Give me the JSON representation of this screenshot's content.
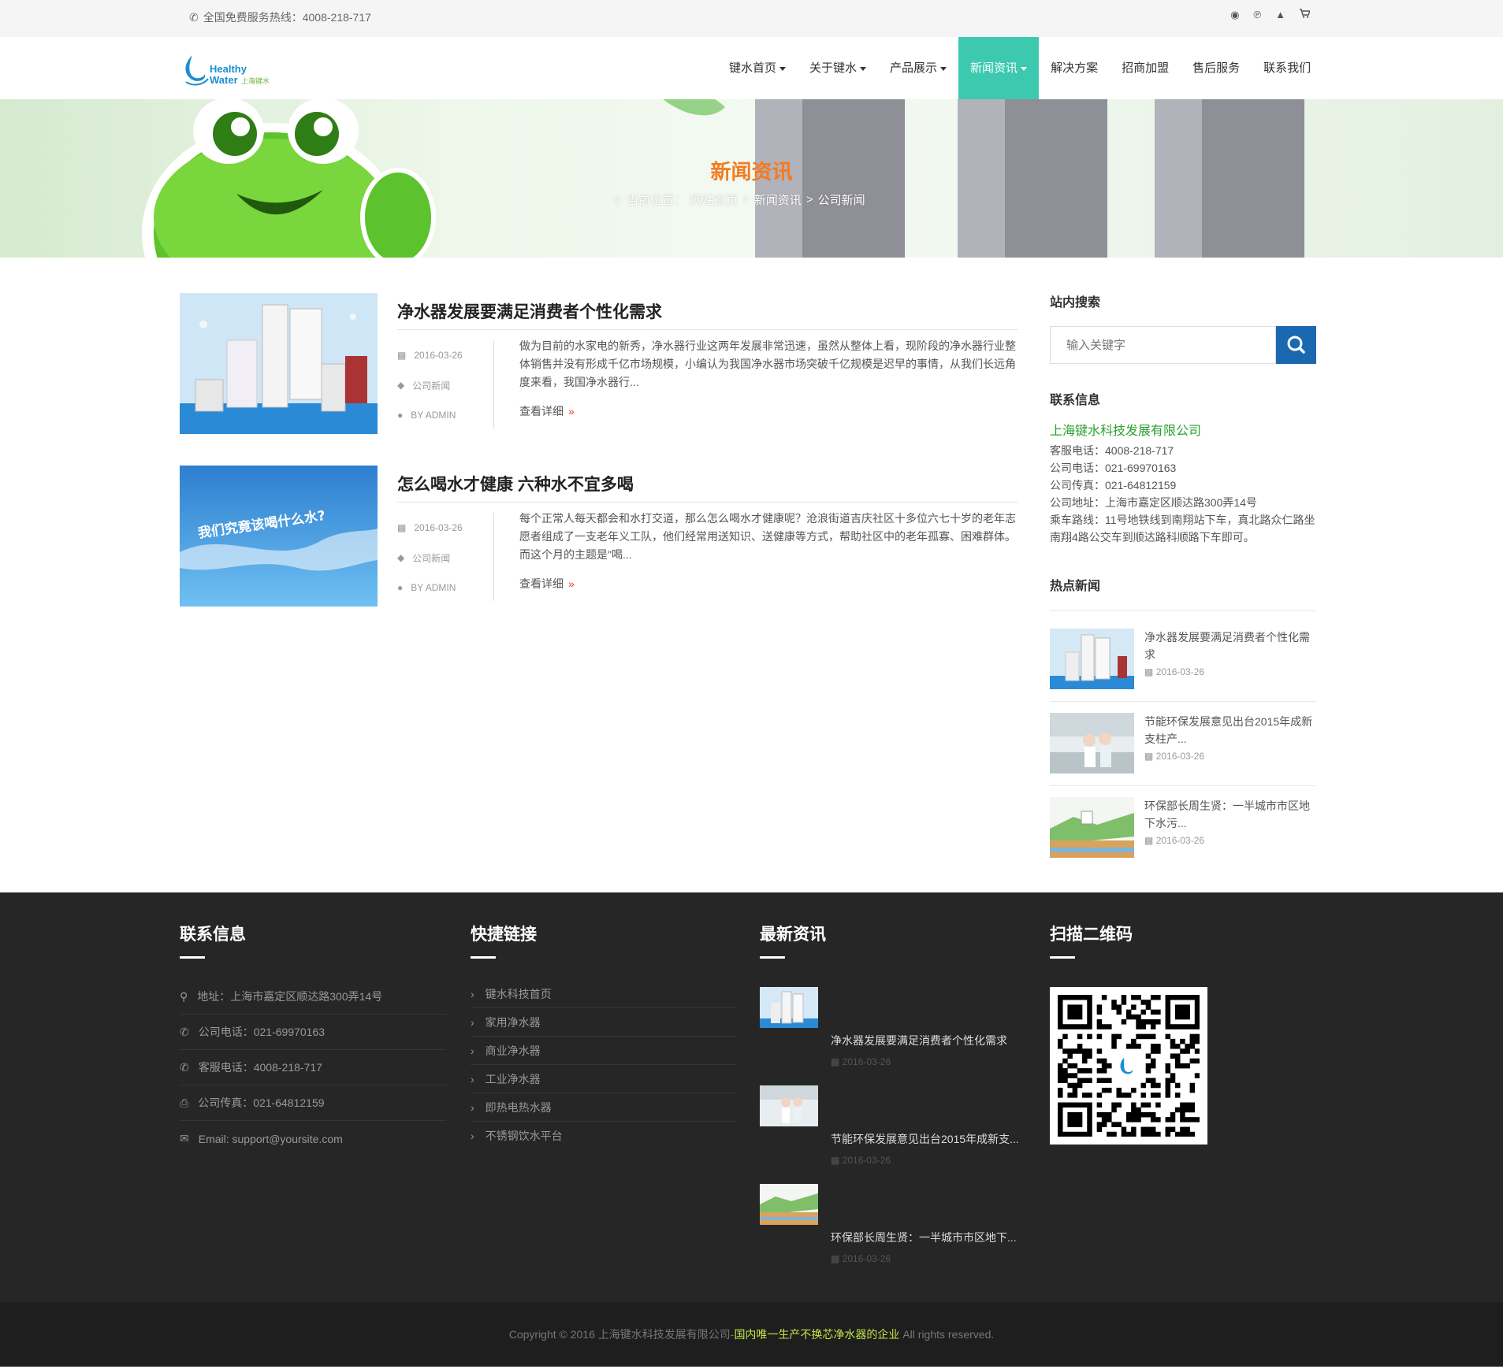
{
  "topbar": {
    "hotline": "全国免费服务热线：4008-218-717",
    "icons": [
      "weibo-icon",
      "pinterest-icon",
      "qq-icon",
      "cart-icon"
    ]
  },
  "logo": {
    "line1": "Healthy",
    "line2": "Water",
    "cn": "上海键水"
  },
  "nav": {
    "items": [
      {
        "label": "键水首页",
        "dropdown": true
      },
      {
        "label": "关于键水",
        "dropdown": true
      },
      {
        "label": "产品展示",
        "dropdown": true
      },
      {
        "label": "新闻资讯",
        "dropdown": true,
        "active": true
      },
      {
        "label": "解决方案",
        "dropdown": false
      },
      {
        "label": "招商加盟",
        "dropdown": false
      },
      {
        "label": "售后服务",
        "dropdown": false
      },
      {
        "label": "联系我们",
        "dropdown": false
      }
    ],
    "active_color": "#3dc9b0"
  },
  "banner": {
    "title": "新闻资讯",
    "breadcrumb": {
      "prefix": "当前位置：",
      "home": "网站首页",
      "sep": ">",
      "section": "新闻资讯",
      "current": "公司新闻"
    }
  },
  "posts": [
    {
      "title": "净水器发展要满足消费者个性化需求",
      "date": "2016-03-26",
      "category": "公司新闻",
      "author": "BY ADMIN",
      "excerpt": "做为目前的水家电的新秀，净水器行业这两年发展非常迅速，虽然从整体上看，现阶段的净水器行业整体销售并没有形成千亿市场规模，小编认为我国净水器市场突破千亿规模是迟早的事情，从我们长远角度来看，我国净水器行...",
      "more": "查看详细"
    },
    {
      "title": "怎么喝水才健康 六种水不宜多喝",
      "date": "2016-03-26",
      "category": "公司新闻",
      "author": "BY ADMIN",
      "excerpt": "每个正常人每天都会和水打交道，那么怎么喝水才健康呢？沧浪街道吉庆社区十多位六七十岁的老年志愿者组成了一支老年义工队，他们经常用送知识、送健康等方式，帮助社区中的老年孤寡、困难群体。而这个月的主题是\"喝...",
      "more": "查看详细",
      "thumb_text": "我们究竟该喝什么水?"
    }
  ],
  "sidebar": {
    "search_title": "站内搜索",
    "search_placeholder": "输入关键字",
    "contact_title": "联系信息",
    "company": "上海键水科技发展有限公司",
    "contact_lines": [
      "客服电话：4008-218-717",
      "公司电话：021-69970163",
      "公司传真：021-64812159",
      "公司地址：上海市嘉定区顺达路300弄14号",
      "乘车路线：11号地铁线到南翔站下车，真北路众仁路坐南翔4路公交车到顺达路科顺路下车即可。"
    ],
    "hot_title": "热点新闻",
    "hot_news": [
      {
        "title": "净水器发展要满足消费者个性化需求",
        "date": "2016-03-26"
      },
      {
        "title": "节能环保发展意见出台2015年成新支柱产...",
        "date": "2016-03-26"
      },
      {
        "title": "环保部长周生贤：一半城市市区地下水污...",
        "date": "2016-03-26"
      }
    ]
  },
  "footer": {
    "contact_title": "联系信息",
    "contact": [
      {
        "icon": "map-marker-icon",
        "text": "地址：上海市嘉定区顺达路300弄14号"
      },
      {
        "icon": "phone-icon",
        "text": "公司电话：021-69970163"
      },
      {
        "icon": "phone-icon",
        "text": "客服电话：4008-218-717"
      },
      {
        "icon": "fax-icon",
        "text": "公司传真：021-64812159"
      },
      {
        "icon": "envelope-icon",
        "text": "Email: support@yoursite.com"
      }
    ],
    "links_title": "快捷链接",
    "links": [
      "键水科技首页",
      "家用净水器",
      "商业净水器",
      "工业净水器",
      "即热电热水器",
      "不锈钢饮水平台"
    ],
    "news_title": "最新资讯",
    "news": [
      {
        "title": "净水器发展要满足消费者个性化需求",
        "date": "2016-03-26"
      },
      {
        "title": "节能环保发展意见出台2015年成新支...",
        "date": "2016-03-26"
      },
      {
        "title": "环保部长周生贤：一半城市市区地下...",
        "date": "2016-03-26"
      }
    ],
    "qr_title": "扫描二维码"
  },
  "copyright": {
    "prefix": "Copyright © 2016 上海键水科技发展有限公司-",
    "highlight": "国内唯一生产不换芯净水器的企业",
    "suffix": " All rights reserved."
  }
}
